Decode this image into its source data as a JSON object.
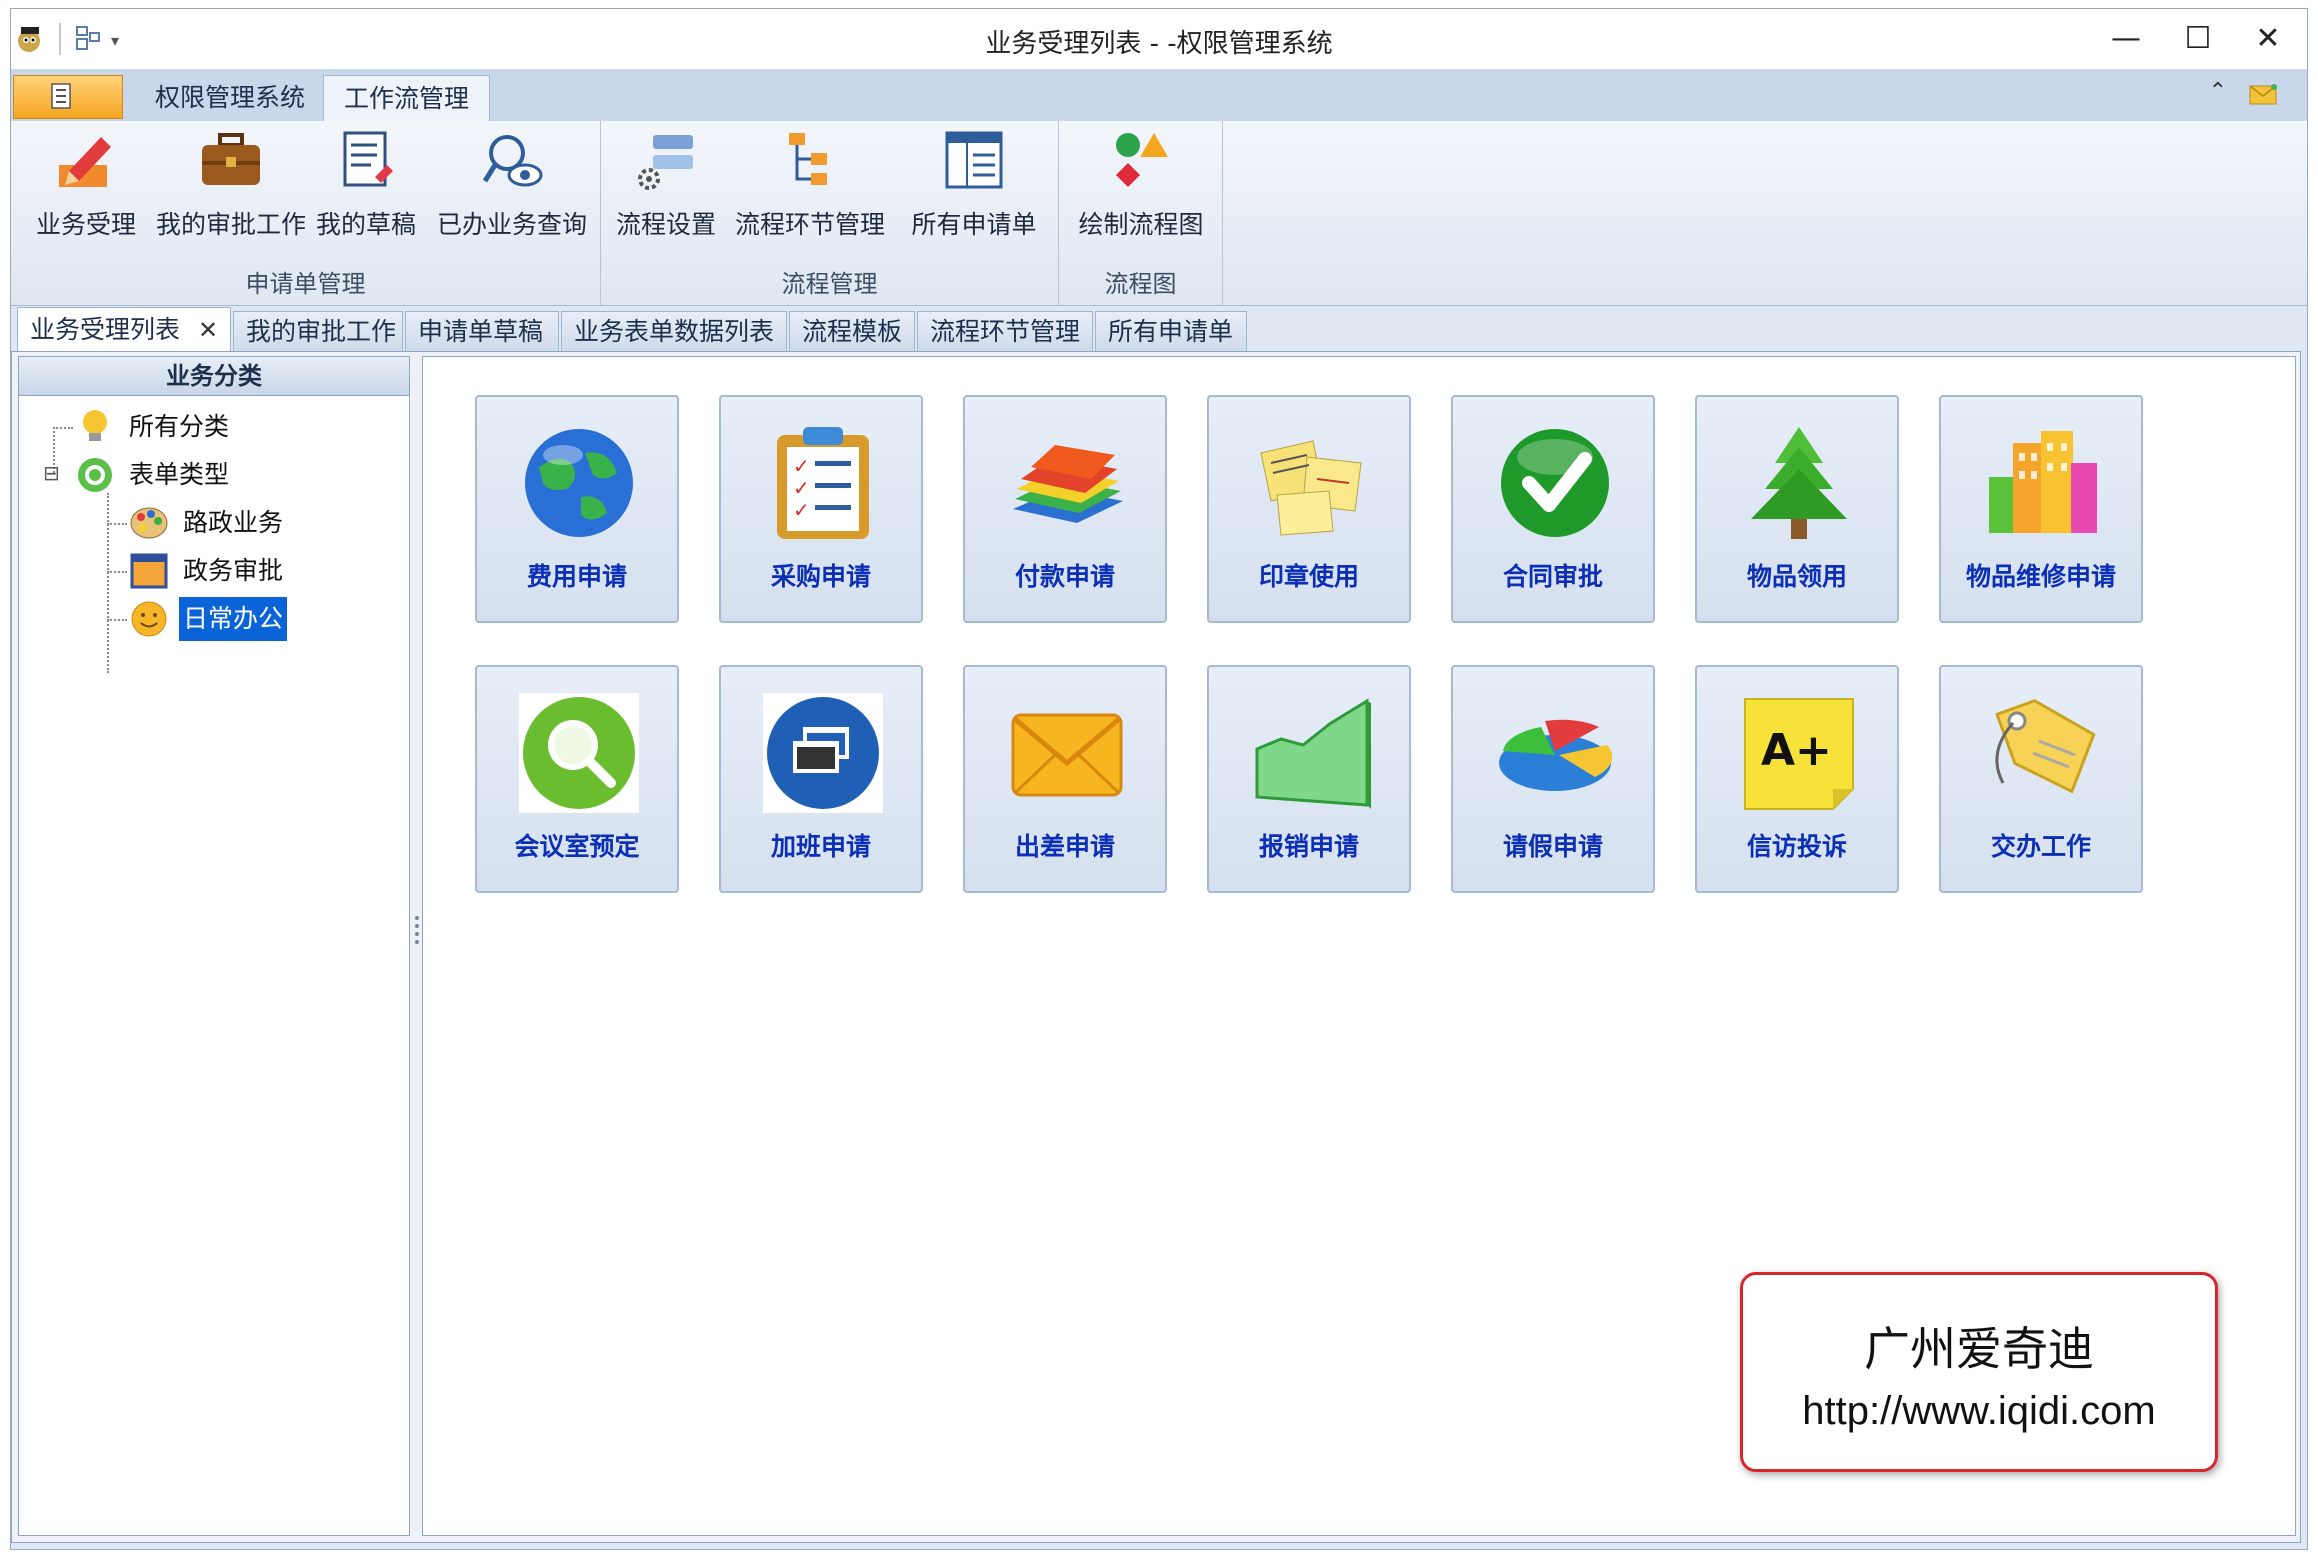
{
  "window": {
    "title": "业务受理列表 - -权限管理系统",
    "controls": {
      "minimize": "—",
      "maximize": "☐",
      "close": "✕"
    }
  },
  "ribbon": {
    "tabs": [
      {
        "label": "权限管理系统",
        "active": false
      },
      {
        "label": "工作流管理",
        "active": true
      }
    ],
    "groups": [
      {
        "label": "申请单管理",
        "buttons": [
          {
            "label": "业务受理",
            "icon": "edit-pencil-icon"
          },
          {
            "label": "我的审批工作",
            "icon": "briefcase-icon"
          },
          {
            "label": "我的草稿",
            "icon": "draft-document-icon"
          },
          {
            "label": "已办业务查询",
            "icon": "search-eye-icon"
          }
        ]
      },
      {
        "label": "流程管理",
        "buttons": [
          {
            "label": "流程设置",
            "icon": "flow-settings-icon"
          },
          {
            "label": "流程环节管理",
            "icon": "flow-steps-icon"
          },
          {
            "label": "所有申请单",
            "icon": "list-document-icon"
          }
        ]
      },
      {
        "label": "流程图",
        "buttons": [
          {
            "label": "绘制流程图",
            "icon": "shapes-icon"
          }
        ]
      }
    ]
  },
  "doc_tabs": [
    {
      "label": "业务受理列表",
      "active": true,
      "close": "✕"
    },
    {
      "label": "我的审批工作",
      "active": false
    },
    {
      "label": "申请单草稿",
      "active": false
    },
    {
      "label": "业务表单数据列表",
      "active": false
    },
    {
      "label": "流程模板",
      "active": false
    },
    {
      "label": "流程环节管理",
      "active": false
    },
    {
      "label": "所有申请单",
      "active": false
    }
  ],
  "left_panel": {
    "title": "业务分类",
    "tree": [
      {
        "label": "所有分类",
        "icon": "lightbulb-icon",
        "selected": false
      },
      {
        "label": "表单类型",
        "icon": "recycle-icon",
        "expander": "⊟",
        "selected": false
      },
      {
        "label": "路政业务",
        "icon": "palette-icon",
        "selected": false
      },
      {
        "label": "政务审批",
        "icon": "window-icon",
        "selected": false
      },
      {
        "label": "日常办公",
        "icon": "smiley-icon",
        "selected": true
      }
    ]
  },
  "tiles": [
    {
      "label": "费用申请",
      "icon": "globe-icon"
    },
    {
      "label": "采购申请",
      "icon": "clipboard-checklist-icon"
    },
    {
      "label": "付款申请",
      "icon": "books-icon"
    },
    {
      "label": "印章使用",
      "icon": "sticky-notes-icon"
    },
    {
      "label": "合同审批",
      "icon": "checkmark-icon"
    },
    {
      "label": "物品领用",
      "icon": "tree-icon"
    },
    {
      "label": "物品维修申请",
      "icon": "buildings-icon"
    },
    {
      "label": "会议室预定",
      "icon": "magnifier-icon"
    },
    {
      "label": "加班申请",
      "icon": "windows-icon"
    },
    {
      "label": "出差申请",
      "icon": "envelope-icon"
    },
    {
      "label": "报销申请",
      "icon": "area-chart-icon"
    },
    {
      "label": "请假申请",
      "icon": "pie-chart-icon"
    },
    {
      "label": "信访投诉",
      "icon": "grade-note-icon"
    },
    {
      "label": "交办工作",
      "icon": "tag-icon"
    }
  ],
  "watermark": {
    "line1": "广州爱奇迪",
    "line2": "http://www.iqidi.com"
  },
  "colors": {
    "accent": "#0a64d8",
    "tile_label": "#0b2fb5",
    "watermark_border": "#d9262c"
  }
}
